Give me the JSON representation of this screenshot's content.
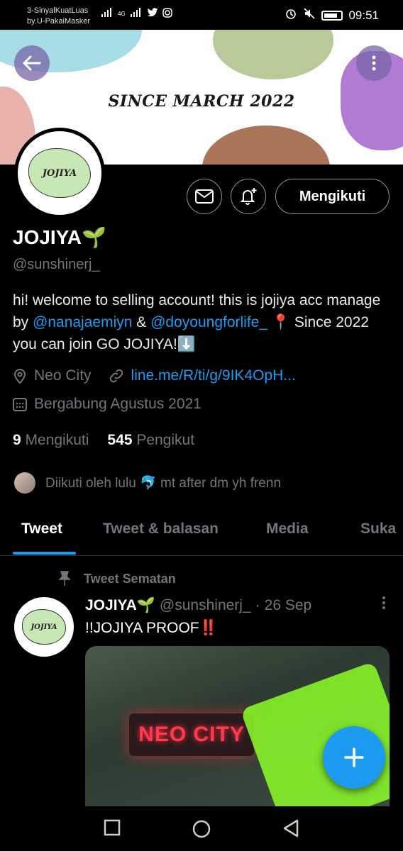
{
  "status_bar": {
    "carrier_line1": "3-SinyalKuatLuas",
    "carrier_line2": "by.U-PakaiMasker",
    "time": "09:51",
    "network": "4G"
  },
  "banner": {
    "title": "SINCE MARCH 2022",
    "colors": {
      "blue": "#a8dde6",
      "green": "#b9c99a",
      "pink": "#e8b3ad",
      "purple": "#b27bd3",
      "brown": "#a9765a"
    }
  },
  "profile": {
    "avatar_text": "JOJIYA",
    "display_name": "JOJIYA",
    "display_emoji": "🌱",
    "handle": "@sunshinerj_",
    "follow_label": "Mengikuti",
    "bio_part1": "hi! welcome to selling account! this is jojiya acc manage by ",
    "bio_mention1": "@nanajaemiyn",
    "bio_part2": " & ",
    "bio_mention2": "@doyoungforlife_",
    "bio_part3": " 📍 Since 2022 you can join GO JOJIYA!⬇️",
    "location": "Neo City",
    "url": "line.me/R/ti/g/9IK4OpH...",
    "joined": "Bergabung Agustus 2021",
    "following_count": "9",
    "following_label": "Mengikuti",
    "followers_count": "545",
    "followers_label": "Pengikut",
    "followed_by": "Diikuti oleh lulu 🐬 mt after dm yh frenn"
  },
  "tabs": [
    {
      "label": "Tweet",
      "active": true
    },
    {
      "label": "Tweet & balasan",
      "active": false
    },
    {
      "label": "Media",
      "active": false
    },
    {
      "label": "Suka",
      "active": false
    }
  ],
  "pinned_tweet": {
    "pinned_label": "Tweet Sematan",
    "author_name": "JOJIYA🌱",
    "author_handle": "@sunshinerj_",
    "separator": "·",
    "date": "26 Sep",
    "text": "!!JOJIYA PROOF‼️",
    "media_sign_text": "NEO CITY"
  },
  "icons": {
    "back": "arrow-left-icon",
    "more": "more-vertical-icon",
    "message": "envelope-icon",
    "notify": "bell-plus-icon",
    "location": "location-pin-icon",
    "link": "link-icon",
    "calendar": "calendar-icon",
    "pin": "pin-icon",
    "compose": "plus-icon"
  },
  "accent_color": "#1d9bf0"
}
